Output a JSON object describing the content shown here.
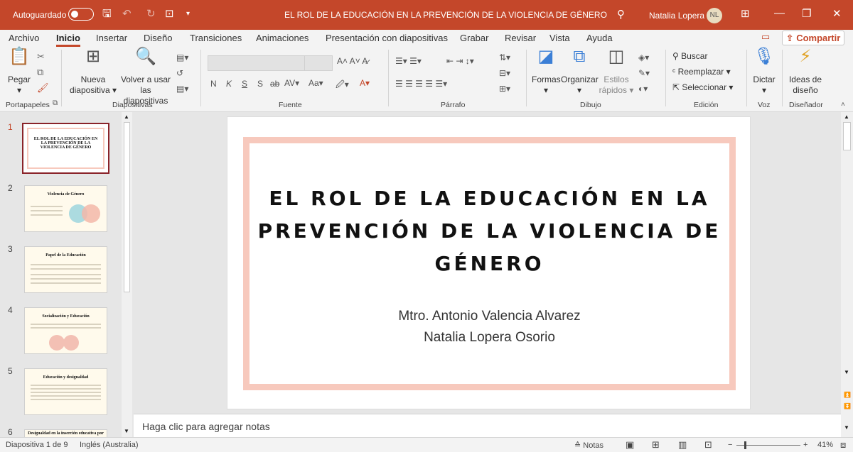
{
  "titlebar": {
    "autosave": "Autoguardado",
    "title": "EL ROL DE LA EDUCACIÓN EN LA PREVENCIÓN DE LA VIOLENCIA DE GÉNERO",
    "user": "Natalia Lopera",
    "initials": "NL",
    "accent": "#c4472a"
  },
  "tabs": [
    "Archivo",
    "Inicio",
    "Insertar",
    "Diseño",
    "Transiciones",
    "Animaciones",
    "Presentación con diapositivas",
    "Grabar",
    "Revisar",
    "Vista",
    "Ayuda"
  ],
  "share": "Compartir",
  "ribbon": {
    "paste": "Pegar",
    "new_slide": [
      "Nueva",
      "diapositiva"
    ],
    "reuse": [
      "Volver a usar",
      "las diapositivas"
    ],
    "shapes": "Formas",
    "arrange": "Organizar",
    "quick_styles": [
      "Estilos",
      "rápidos"
    ],
    "find": "Buscar",
    "replace": "Reemplazar",
    "select": "Seleccionar",
    "dictate": "Dictar",
    "designer": [
      "Ideas de",
      "diseño"
    ],
    "font_buttons": [
      "N",
      "K",
      "S",
      "S",
      "ab"
    ],
    "groups": [
      "Portapapeles",
      "Diapositivas",
      "Fuente",
      "Párrafo",
      "Dibujo",
      "Edición",
      "Voz",
      "Diseñador"
    ]
  },
  "thumbnails": [
    {
      "num": "1",
      "title": "EL ROL DE LA EDUCACIÓN EN LA PREVENCIÓN DE LA VIOLENCIA DE GÉNERO"
    },
    {
      "num": "2",
      "title": "Violencia de Género"
    },
    {
      "num": "3",
      "title": "Papel de la Educación"
    },
    {
      "num": "4",
      "title": "Socialización y Educación"
    },
    {
      "num": "5",
      "title": "Educación y desigualdad"
    },
    {
      "num": "6",
      "title": "Desigualdad en la inserción educativa por"
    }
  ],
  "slide": {
    "title": "EL ROL DE LA EDUCACIÓN EN LA PREVENCIÓN DE LA VIOLENCIA DE GÉNERO",
    "authors": [
      "Mtro. Antonio Valencia Alvarez",
      "Natalia Lopera Osorio"
    ]
  },
  "notes_placeholder": "Haga clic para agregar notas",
  "status": {
    "slide": "Diapositiva 1 de 9",
    "lang": "Inglés (Australia)",
    "notes": "Notas",
    "zoom": "41%"
  }
}
